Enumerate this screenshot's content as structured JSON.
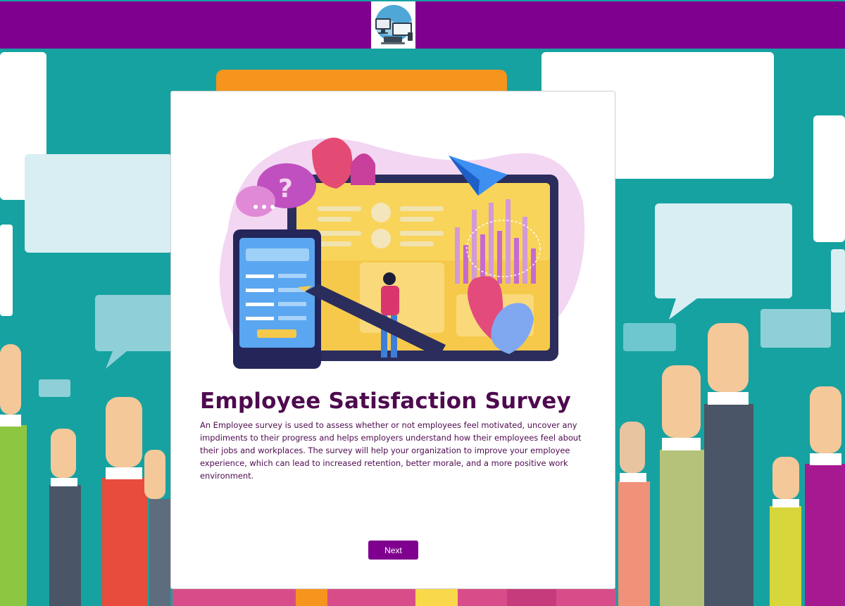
{
  "header": {
    "logo_icon": "computer-devices-icon",
    "bar_color": "#7f008f"
  },
  "background": {
    "theme": "raised-hands-with-speech-bubbles",
    "colors": {
      "teal": "#16a2a0",
      "bubble": "#ffffff"
    }
  },
  "survey": {
    "illustration": "online-survey-illustration",
    "title": "Employee Satisfaction Survey",
    "description": "An Employee survey is used to assess whether or not employees feel motivated, uncover any impdiments to their progress and helps employers understand how their employees feel about their jobs and workplaces. The survey will help your organization to improve your employee experience, which can lead to increased retention, better morale, and a more positive work environment.",
    "next_label": "Next",
    "title_color": "#4e0a4f",
    "button_color": "#7f008f"
  }
}
